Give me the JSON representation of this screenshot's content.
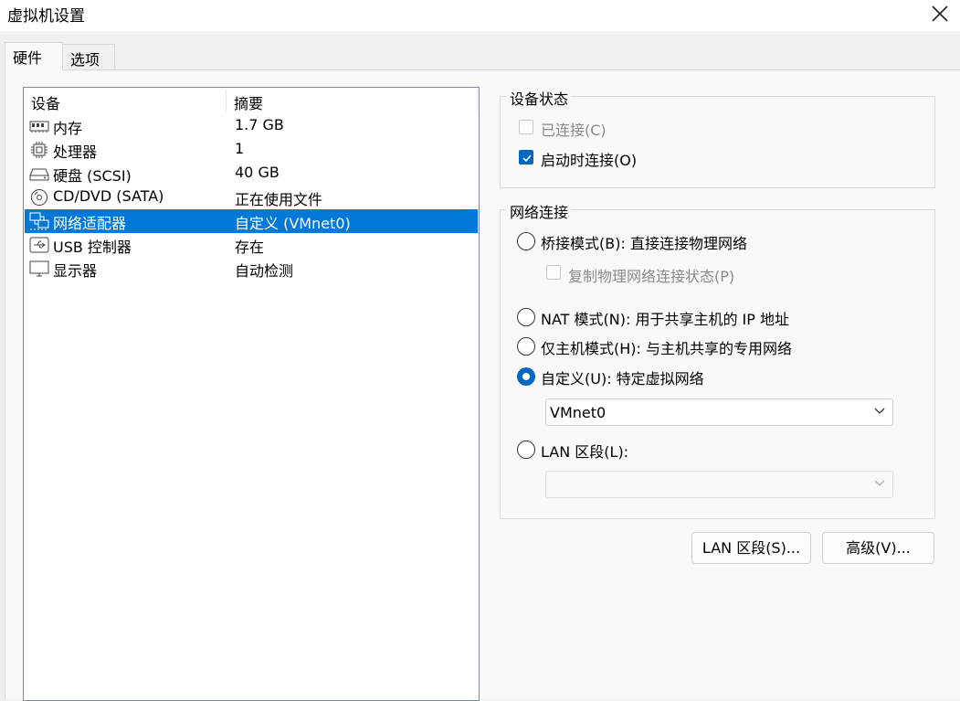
{
  "window": {
    "title": "虚拟机设置"
  },
  "tabs": [
    {
      "label": "硬件"
    },
    {
      "label": "选项"
    }
  ],
  "hardware_list": {
    "columns": [
      "设备",
      "摘要"
    ],
    "rows": [
      {
        "name": "内存",
        "summary": "1.7 GB",
        "icon": "memory-icon"
      },
      {
        "name": "处理器",
        "summary": "1",
        "icon": "cpu-icon"
      },
      {
        "name": "硬盘 (SCSI)",
        "summary": "40 GB",
        "icon": "hard-disk-icon"
      },
      {
        "name": "CD/DVD (SATA)",
        "summary": "正在使用文件",
        "icon": "cd-dvd-icon"
      },
      {
        "name": "网络适配器",
        "summary": "自定义 (VMnet0)",
        "icon": "network-adapter-icon",
        "selected": true
      },
      {
        "name": "USB 控制器",
        "summary": "存在",
        "icon": "usb-icon"
      },
      {
        "name": "显示器",
        "summary": "自动检测",
        "icon": "monitor-icon"
      }
    ]
  },
  "device_status": {
    "title": "设备状态",
    "connected": {
      "label": "已连接(C)",
      "checked": false,
      "enabled": false
    },
    "connect_at_power_on": {
      "label": "启动时连接(O)",
      "checked": true,
      "enabled": true
    }
  },
  "network": {
    "title": "网络连接",
    "bridged": {
      "label": "桥接模式(B): 直接连接物理网络",
      "selected": false
    },
    "replicate": {
      "label": "复制物理网络连接状态(P)",
      "checked": false,
      "enabled": false
    },
    "nat": {
      "label": "NAT 模式(N): 用于共享主机的 IP 地址",
      "selected": false
    },
    "host_only": {
      "label": "仅主机模式(H): 与主机共享的专用网络",
      "selected": false
    },
    "custom": {
      "label": "自定义(U): 特定虚拟网络",
      "selected": true,
      "value": "VMnet0"
    },
    "lan_segment": {
      "label": "LAN 区段(L):",
      "selected": false,
      "value": ""
    }
  },
  "buttons": {
    "lan_segments": "LAN 区段(S)...",
    "advanced": "高级(V)..."
  },
  "colors": {
    "accent": "#0067c0",
    "selection": "#0078d7"
  }
}
